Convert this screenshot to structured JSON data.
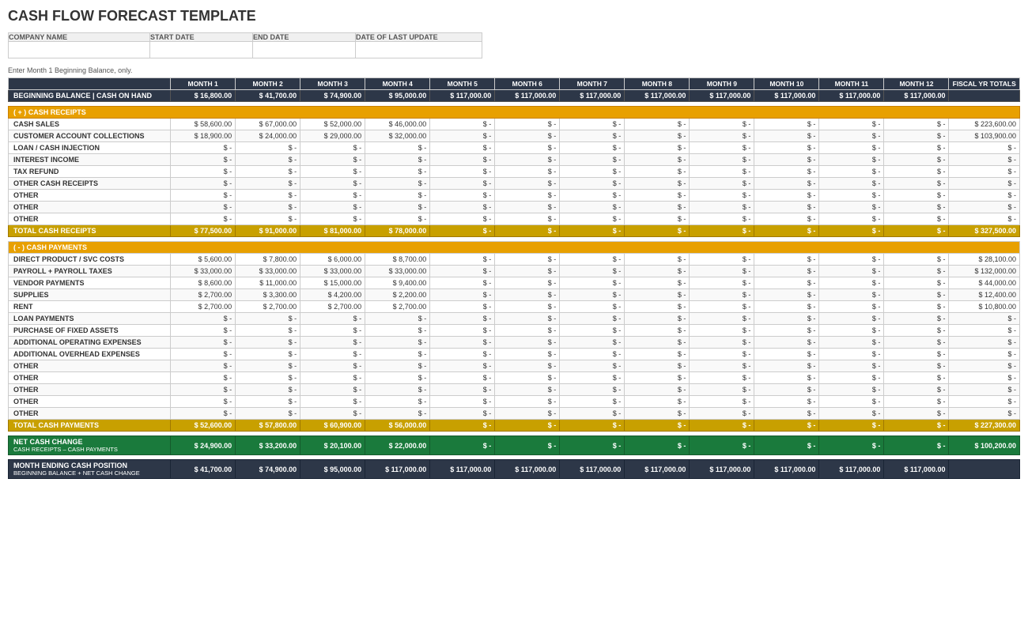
{
  "title": "CASH FLOW FORECAST TEMPLATE",
  "header": {
    "company_name_label": "COMPANY NAME",
    "start_date_label": "START DATE",
    "end_date_label": "END DATE",
    "last_update_label": "DATE OF LAST UPDATE"
  },
  "note": "Enter Month 1 Beginning Balance, only.",
  "months": [
    "MONTH 1",
    "MONTH 2",
    "MONTH 3",
    "MONTH 4",
    "MONTH 5",
    "MONTH 6",
    "MONTH 7",
    "MONTH 8",
    "MONTH 9",
    "MONTH 10",
    "MONTH 11",
    "MONTH 12"
  ],
  "fiscal_label": "FISCAL YR TOTALS",
  "beginning_balance_label": "BEGINNING BALANCE | CASH ON HAND",
  "beginning_balance": [
    "$ 16,800.00",
    "$ 41,700.00",
    "$ 74,900.00",
    "$ 95,000.00",
    "$ 117,000.00",
    "$ 117,000.00",
    "$ 117,000.00",
    "$ 117,000.00",
    "$ 117,000.00",
    "$ 117,000.00",
    "$ 117,000.00",
    "$ 117,000.00"
  ],
  "cash_receipts_header": "( + )  CASH RECEIPTS",
  "receipts_rows": [
    {
      "label": "CASH SALES",
      "values": [
        "$ 58,600.00",
        "$ 67,000.00",
        "$ 52,000.00",
        "$ 46,000.00",
        "$ -",
        "$ -",
        "$ -",
        "$ -",
        "$ -",
        "$ -",
        "$ -",
        "$ -"
      ],
      "fiscal": "$ 223,600.00"
    },
    {
      "label": "CUSTOMER ACCOUNT COLLECTIONS",
      "values": [
        "$ 18,900.00",
        "$ 24,000.00",
        "$ 29,000.00",
        "$ 32,000.00",
        "$ -",
        "$ -",
        "$ -",
        "$ -",
        "$ -",
        "$ -",
        "$ -",
        "$ -"
      ],
      "fiscal": "$ 103,900.00"
    },
    {
      "label": "LOAN / CASH INJECTION",
      "values": [
        "$ -",
        "$ -",
        "$ -",
        "$ -",
        "$ -",
        "$ -",
        "$ -",
        "$ -",
        "$ -",
        "$ -",
        "$ -",
        "$ -"
      ],
      "fiscal": "$ -"
    },
    {
      "label": "INTEREST INCOME",
      "values": [
        "$ -",
        "$ -",
        "$ -",
        "$ -",
        "$ -",
        "$ -",
        "$ -",
        "$ -",
        "$ -",
        "$ -",
        "$ -",
        "$ -"
      ],
      "fiscal": "$ -"
    },
    {
      "label": "TAX REFUND",
      "values": [
        "$ -",
        "$ -",
        "$ -",
        "$ -",
        "$ -",
        "$ -",
        "$ -",
        "$ -",
        "$ -",
        "$ -",
        "$ -",
        "$ -"
      ],
      "fiscal": "$ -"
    },
    {
      "label": "OTHER CASH RECEIPTS",
      "values": [
        "$ -",
        "$ -",
        "$ -",
        "$ -",
        "$ -",
        "$ -",
        "$ -",
        "$ -",
        "$ -",
        "$ -",
        "$ -",
        "$ -"
      ],
      "fiscal": "$ -"
    },
    {
      "label": "OTHER",
      "values": [
        "$ -",
        "$ -",
        "$ -",
        "$ -",
        "$ -",
        "$ -",
        "$ -",
        "$ -",
        "$ -",
        "$ -",
        "$ -",
        "$ -"
      ],
      "fiscal": "$ -"
    },
    {
      "label": "OTHER",
      "values": [
        "$ -",
        "$ -",
        "$ -",
        "$ -",
        "$ -",
        "$ -",
        "$ -",
        "$ -",
        "$ -",
        "$ -",
        "$ -",
        "$ -"
      ],
      "fiscal": "$ -"
    },
    {
      "label": "OTHER",
      "values": [
        "$ -",
        "$ -",
        "$ -",
        "$ -",
        "$ -",
        "$ -",
        "$ -",
        "$ -",
        "$ -",
        "$ -",
        "$ -",
        "$ -"
      ],
      "fiscal": "$ -"
    }
  ],
  "total_receipts_label": "TOTAL CASH RECEIPTS",
  "total_receipts": [
    "$ 77,500.00",
    "$ 91,000.00",
    "$ 81,000.00",
    "$ 78,000.00",
    "$ -",
    "$ -",
    "$ -",
    "$ -",
    "$ -",
    "$ -",
    "$ -",
    "$ -"
  ],
  "total_receipts_fiscal": "$ 327,500.00",
  "cash_payments_header": "( - )  CASH PAYMENTS",
  "payments_rows": [
    {
      "label": "DIRECT PRODUCT / SVC COSTS",
      "values": [
        "$ 5,600.00",
        "$ 7,800.00",
        "$ 6,000.00",
        "$ 8,700.00",
        "$ -",
        "$ -",
        "$ -",
        "$ -",
        "$ -",
        "$ -",
        "$ -",
        "$ -"
      ],
      "fiscal": "$ 28,100.00"
    },
    {
      "label": "PAYROLL + PAYROLL TAXES",
      "values": [
        "$ 33,000.00",
        "$ 33,000.00",
        "$ 33,000.00",
        "$ 33,000.00",
        "$ -",
        "$ -",
        "$ -",
        "$ -",
        "$ -",
        "$ -",
        "$ -",
        "$ -"
      ],
      "fiscal": "$ 132,000.00"
    },
    {
      "label": "VENDOR PAYMENTS",
      "values": [
        "$ 8,600.00",
        "$ 11,000.00",
        "$ 15,000.00",
        "$ 9,400.00",
        "$ -",
        "$ -",
        "$ -",
        "$ -",
        "$ -",
        "$ -",
        "$ -",
        "$ -"
      ],
      "fiscal": "$ 44,000.00"
    },
    {
      "label": "SUPPLIES",
      "values": [
        "$ 2,700.00",
        "$ 3,300.00",
        "$ 4,200.00",
        "$ 2,200.00",
        "$ -",
        "$ -",
        "$ -",
        "$ -",
        "$ -",
        "$ -",
        "$ -",
        "$ -"
      ],
      "fiscal": "$ 12,400.00"
    },
    {
      "label": "RENT",
      "values": [
        "$ 2,700.00",
        "$ 2,700.00",
        "$ 2,700.00",
        "$ 2,700.00",
        "$ -",
        "$ -",
        "$ -",
        "$ -",
        "$ -",
        "$ -",
        "$ -",
        "$ -"
      ],
      "fiscal": "$ 10,800.00"
    },
    {
      "label": "LOAN PAYMENTS",
      "values": [
        "$ -",
        "$ -",
        "$ -",
        "$ -",
        "$ -",
        "$ -",
        "$ -",
        "$ -",
        "$ -",
        "$ -",
        "$ -",
        "$ -"
      ],
      "fiscal": "$ -"
    },
    {
      "label": "PURCHASE OF FIXED ASSETS",
      "values": [
        "$ -",
        "$ -",
        "$ -",
        "$ -",
        "$ -",
        "$ -",
        "$ -",
        "$ -",
        "$ -",
        "$ -",
        "$ -",
        "$ -"
      ],
      "fiscal": "$ -"
    },
    {
      "label": "ADDITIONAL OPERATING EXPENSES",
      "values": [
        "$ -",
        "$ -",
        "$ -",
        "$ -",
        "$ -",
        "$ -",
        "$ -",
        "$ -",
        "$ -",
        "$ -",
        "$ -",
        "$ -"
      ],
      "fiscal": "$ -"
    },
    {
      "label": "ADDITIONAL OVERHEAD EXPENSES",
      "values": [
        "$ -",
        "$ -",
        "$ -",
        "$ -",
        "$ -",
        "$ -",
        "$ -",
        "$ -",
        "$ -",
        "$ -",
        "$ -",
        "$ -"
      ],
      "fiscal": "$ -"
    },
    {
      "label": "OTHER",
      "values": [
        "$ -",
        "$ -",
        "$ -",
        "$ -",
        "$ -",
        "$ -",
        "$ -",
        "$ -",
        "$ -",
        "$ -",
        "$ -",
        "$ -"
      ],
      "fiscal": "$ -"
    },
    {
      "label": "OTHER",
      "values": [
        "$ -",
        "$ -",
        "$ -",
        "$ -",
        "$ -",
        "$ -",
        "$ -",
        "$ -",
        "$ -",
        "$ -",
        "$ -",
        "$ -"
      ],
      "fiscal": "$ -"
    },
    {
      "label": "OTHER",
      "values": [
        "$ -",
        "$ -",
        "$ -",
        "$ -",
        "$ -",
        "$ -",
        "$ -",
        "$ -",
        "$ -",
        "$ -",
        "$ -",
        "$ -"
      ],
      "fiscal": "$ -"
    },
    {
      "label": "OTHER",
      "values": [
        "$ -",
        "$ -",
        "$ -",
        "$ -",
        "$ -",
        "$ -",
        "$ -",
        "$ -",
        "$ -",
        "$ -",
        "$ -",
        "$ -"
      ],
      "fiscal": "$ -"
    },
    {
      "label": "OTHER",
      "values": [
        "$ -",
        "$ -",
        "$ -",
        "$ -",
        "$ -",
        "$ -",
        "$ -",
        "$ -",
        "$ -",
        "$ -",
        "$ -",
        "$ -"
      ],
      "fiscal": "$ -"
    }
  ],
  "total_payments_label": "TOTAL CASH PAYMENTS",
  "total_payments": [
    "$ 52,600.00",
    "$ 57,800.00",
    "$ 60,900.00",
    "$ 56,000.00",
    "$ -",
    "$ -",
    "$ -",
    "$ -",
    "$ -",
    "$ -",
    "$ -",
    "$ -"
  ],
  "total_payments_fiscal": "$ 227,300.00",
  "net_cash_label": "NET CASH CHANGE",
  "net_cash_sublabel": "CASH RECEIPTS – CASH PAYMENTS",
  "net_cash": [
    "$ 24,900.00",
    "$ 33,200.00",
    "$ 20,100.00",
    "$ 22,000.00",
    "$ -",
    "$ -",
    "$ -",
    "$ -",
    "$ -",
    "$ -",
    "$ -",
    "$ -"
  ],
  "net_cash_fiscal": "$ 100,200.00",
  "month_ending_label": "MONTH ENDING CASH POSITION",
  "month_ending_sublabel": "BEGINNING BALANCE + NET CASH CHANGE",
  "month_ending": [
    "$ 41,700.00",
    "$ 74,900.00",
    "$ 95,000.00",
    "$ 117,000.00",
    "$ 117,000.00",
    "$ 117,000.00",
    "$ 117,000.00",
    "$ 117,000.00",
    "$ 117,000.00",
    "$ 117,000.00",
    "$ 117,000.00",
    "$ 117,000.00"
  ],
  "month_ending_fiscal": ""
}
